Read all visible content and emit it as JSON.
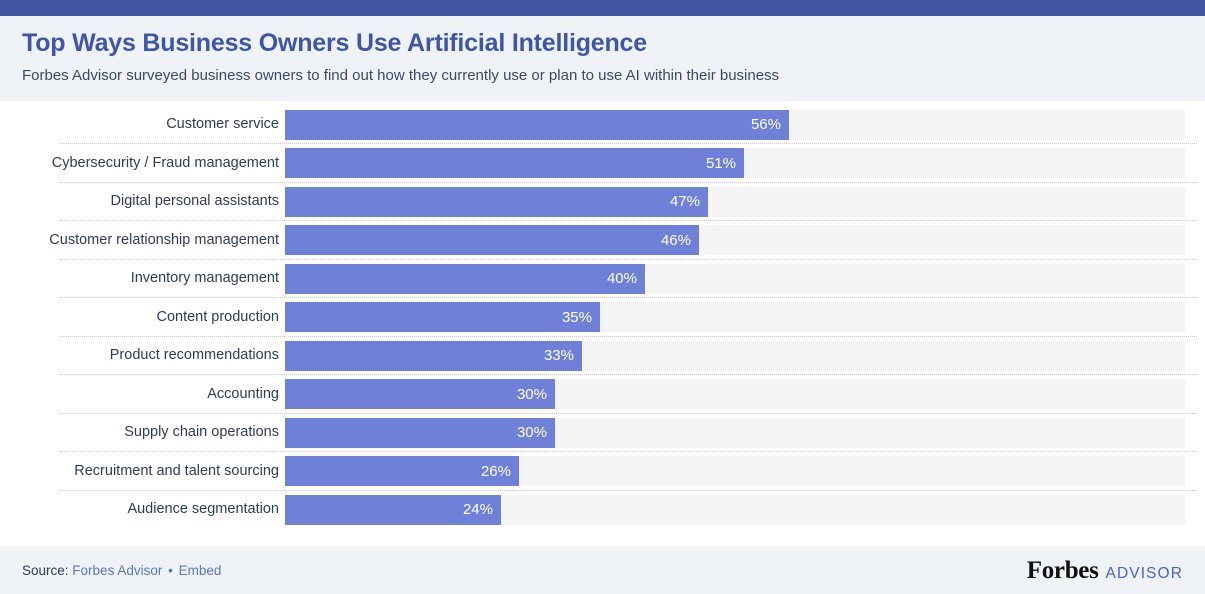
{
  "header": {
    "title": "Top Ways Business Owners Use Artificial Intelligence",
    "subtitle": "Forbes Advisor surveyed business owners to find out how they currently use or plan to use AI within their business"
  },
  "footer": {
    "source_prefix": "Source:",
    "source_name": "Forbes Advisor",
    "separator": "•",
    "embed_label": "Embed",
    "brand_primary": "Forbes",
    "brand_secondary": "ADVISOR"
  },
  "colors": {
    "accent_bar": "#3f55a0",
    "title": "#3e55a8",
    "bar": "#6e80d8",
    "track": "#f4f4f5",
    "panel": "#eff3f8",
    "label_text": "#2e3c55",
    "link": "#5b76c4"
  },
  "chart_data": {
    "type": "bar",
    "orientation": "horizontal",
    "title": "Top Ways Business Owners Use Artificial Intelligence",
    "subtitle": "Forbes Advisor surveyed business owners to find out how they currently use or plan to use AI within their business",
    "xlabel": "",
    "ylabel": "",
    "xlim": [
      0,
      100
    ],
    "unit": "%",
    "grid": false,
    "legend": false,
    "categories": [
      "Customer service",
      "Cybersecurity / Fraud management",
      "Digital personal assistants",
      "Customer relationship management",
      "Inventory management",
      "Content production",
      "Product recommendations",
      "Accounting",
      "Supply chain operations",
      "Recruitment and talent sourcing",
      "Audience segmentation"
    ],
    "values": [
      56,
      51,
      47,
      46,
      40,
      35,
      33,
      30,
      30,
      26,
      24
    ],
    "value_labels": [
      "56%",
      "51%",
      "47%",
      "46%",
      "40%",
      "35%",
      "33%",
      "30%",
      "30%",
      "26%",
      "24%"
    ],
    "bars": [
      {
        "label": "Customer service",
        "value": 56,
        "display": "56%"
      },
      {
        "label": "Cybersecurity / Fraud management",
        "value": 51,
        "display": "51%"
      },
      {
        "label": "Digital personal assistants",
        "value": 47,
        "display": "47%"
      },
      {
        "label": "Customer relationship management",
        "value": 46,
        "display": "46%"
      },
      {
        "label": "Inventory management",
        "value": 40,
        "display": "40%"
      },
      {
        "label": "Content production",
        "value": 35,
        "display": "35%"
      },
      {
        "label": "Product recommendations",
        "value": 33,
        "display": "33%"
      },
      {
        "label": "Accounting",
        "value": 30,
        "display": "30%"
      },
      {
        "label": "Supply chain operations",
        "value": 30,
        "display": "30%"
      },
      {
        "label": "Recruitment and talent sourcing",
        "value": 26,
        "display": "26%"
      },
      {
        "label": "Audience segmentation",
        "value": 24,
        "display": "24%"
      }
    ]
  }
}
